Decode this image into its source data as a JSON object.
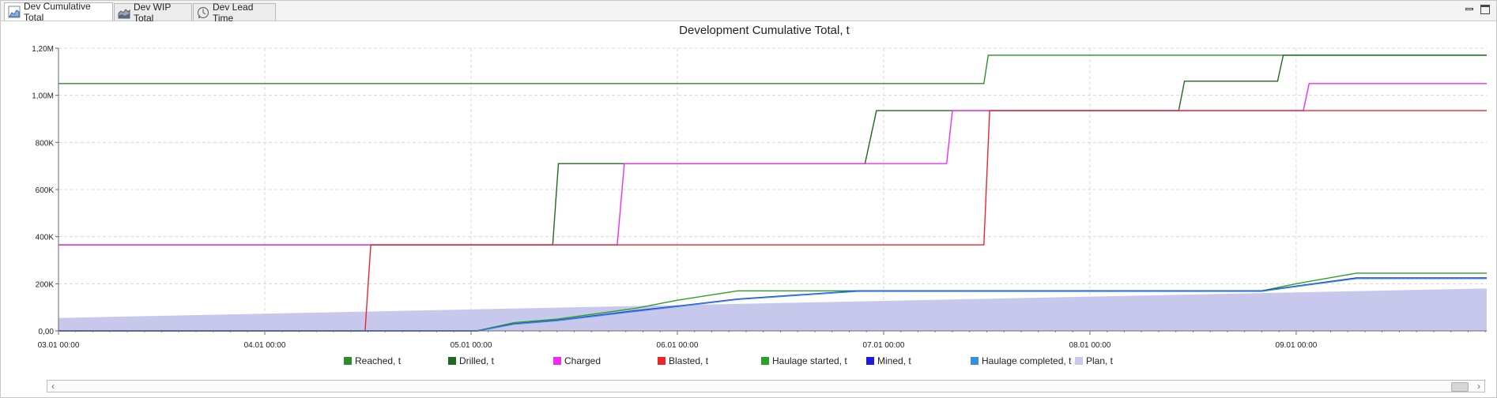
{
  "tabs": [
    {
      "label": "Dev Cumulative Total",
      "icon": "area-chart-icon",
      "active": true
    },
    {
      "label": "Dev WIP Total",
      "icon": "stacked-chart-icon",
      "active": false
    },
    {
      "label": "Dev Lead Time",
      "icon": "clock-chart-icon",
      "active": false
    }
  ],
  "chart_data": {
    "type": "line",
    "title": "Development Cumulative Total, t",
    "xlabel": "",
    "ylabel": "",
    "x_unit": "days",
    "xlim": [
      "03.01 00:00",
      "09.01 22:10"
    ],
    "ylim": [
      0,
      1200000
    ],
    "x_ticks": [
      "03.01 00:00",
      "04.01 00:00",
      "05.01 00:00",
      "06.01 00:00",
      "07.01 00:00",
      "08.01 00:00",
      "09.01 00:00"
    ],
    "y_ticks": [
      {
        "value": 0,
        "label": "0,00"
      },
      {
        "value": 200000,
        "label": "200K"
      },
      {
        "value": 400000,
        "label": "400K"
      },
      {
        "value": 600000,
        "label": "600K"
      },
      {
        "value": 800000,
        "label": "800K"
      },
      {
        "value": 1000000,
        "label": "1,00M"
      },
      {
        "value": 1200000,
        "label": "1,20M"
      }
    ],
    "grid": true,
    "legend_position": "bottom",
    "series": [
      {
        "name": "Plan, t",
        "type": "area",
        "color": "#c8c8ec",
        "points": [
          [
            "03.01 00:00",
            55000
          ],
          [
            "09.01 22:10",
            180000
          ]
        ]
      },
      {
        "name": "Reached, t",
        "color": "#2e8b2e",
        "points": [
          [
            "03.01 00:00",
            1050000
          ],
          [
            "07.01 11:40",
            1050000
          ],
          [
            "07.01 12:10",
            1170000
          ],
          [
            "09.01 22:10",
            1170000
          ]
        ]
      },
      {
        "name": "Drilled, t",
        "color": "#1e6a1e",
        "points": [
          [
            "03.01 00:00",
            365000
          ],
          [
            "05.01 09:30",
            365000
          ],
          [
            "05.01 10:10",
            710000
          ],
          [
            "06.01 21:50",
            710000
          ],
          [
            "06.01 23:10",
            935000
          ],
          [
            "08.01 10:20",
            935000
          ],
          [
            "08.01 11:00",
            1060000
          ],
          [
            "08.01 21:50",
            1060000
          ],
          [
            "08.01 22:30",
            1170000
          ],
          [
            "09.01 22:10",
            1170000
          ]
        ]
      },
      {
        "name": "Charged",
        "color": "#f02cf0",
        "points": [
          [
            "03.01 00:00",
            365000
          ],
          [
            "05.01 17:00",
            365000
          ],
          [
            "05.01 17:50",
            710000
          ],
          [
            "07.01 07:20",
            710000
          ],
          [
            "07.01 08:00",
            935000
          ],
          [
            "09.01 00:50",
            935000
          ],
          [
            "09.01 01:30",
            1050000
          ],
          [
            "09.01 22:10",
            1050000
          ]
        ]
      },
      {
        "name": "Blasted, t",
        "color": "#e8262c",
        "points": [
          [
            "03.01 00:00",
            0
          ],
          [
            "04.01 11:40",
            0
          ],
          [
            "04.01 12:20",
            365000
          ],
          [
            "07.01 11:40",
            365000
          ],
          [
            "07.01 12:20",
            935000
          ],
          [
            "09.01 22:10",
            935000
          ]
        ]
      },
      {
        "name": "Haulage started, t",
        "color": "#27a327",
        "points": [
          [
            "03.01 00:00",
            0
          ],
          [
            "05.01 00:40",
            0
          ],
          [
            "05.01 05:00",
            35000
          ],
          [
            "05.01 10:00",
            50000
          ],
          [
            "05.01 19:00",
            95000
          ],
          [
            "06.01 00:00",
            130000
          ],
          [
            "06.01 07:00",
            170000
          ],
          [
            "06.01 21:00",
            170000
          ],
          [
            "08.01 20:00",
            170000
          ],
          [
            "09.01 00:00",
            200000
          ],
          [
            "09.01 07:00",
            245000
          ],
          [
            "09.01 22:10",
            245000
          ]
        ]
      },
      {
        "name": "Mined, t",
        "color": "#1d1dd8",
        "points": [
          [
            "03.01 00:00",
            0
          ],
          [
            "05.01 00:40",
            0
          ],
          [
            "05.01 05:00",
            30000
          ],
          [
            "05.01 10:00",
            45000
          ],
          [
            "05.01 19:00",
            85000
          ],
          [
            "06.01 00:00",
            105000
          ],
          [
            "06.01 07:00",
            135000
          ],
          [
            "06.01 21:00",
            170000
          ],
          [
            "08.01 20:00",
            170000
          ],
          [
            "09.01 00:00",
            190000
          ],
          [
            "09.01 07:00",
            225000
          ],
          [
            "09.01 22:10",
            225000
          ]
        ]
      },
      {
        "name": "Haulage completed, t",
        "color": "#3a8ee0",
        "points": [
          [
            "03.01 00:00",
            0
          ],
          [
            "05.01 00:50",
            0
          ],
          [
            "05.01 05:00",
            28000
          ],
          [
            "05.01 10:00",
            43000
          ],
          [
            "05.01 19:00",
            82000
          ],
          [
            "06.01 00:00",
            103000
          ],
          [
            "06.01 07:00",
            133000
          ],
          [
            "06.01 21:00",
            168000
          ],
          [
            "08.01 20:00",
            168000
          ],
          [
            "09.01 00:00",
            188000
          ],
          [
            "09.01 07:00",
            222000
          ],
          [
            "09.01 22:10",
            222000
          ]
        ]
      }
    ],
    "legend_order": [
      "Reached, t",
      "Drilled, t",
      "Charged",
      "Blasted, t",
      "Haulage started, t",
      "Mined, t",
      "Haulage completed, t",
      "Plan, t"
    ]
  },
  "scrollbar": {
    "left_arrow": "‹",
    "right_arrow": "›"
  }
}
